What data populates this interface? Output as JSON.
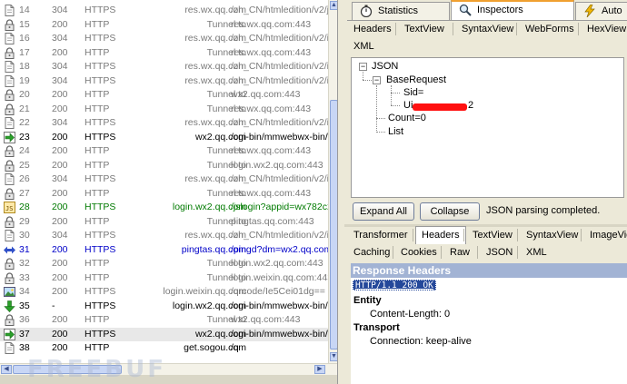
{
  "sessions": [
    {
      "num": "14",
      "result": "304",
      "protocol": "HTTPS",
      "host": "res.wx.qq.com",
      "url": "/zh_CN/htmledition/v2/ji",
      "color": "grey",
      "icon": "document-icon"
    },
    {
      "num": "15",
      "result": "200",
      "protocol": "HTTP",
      "host": "Tunnel to",
      "url": "res.wx.qq.com:443",
      "color": "grey",
      "icon": "lock-icon"
    },
    {
      "num": "16",
      "result": "304",
      "protocol": "HTTPS",
      "host": "res.wx.qq.com",
      "url": "/zh_CN/htmledition/v2/in",
      "color": "grey",
      "icon": "document-icon"
    },
    {
      "num": "17",
      "result": "200",
      "protocol": "HTTP",
      "host": "Tunnel to",
      "url": "res.wx.qq.com:443",
      "color": "grey",
      "icon": "lock-icon"
    },
    {
      "num": "18",
      "result": "304",
      "protocol": "HTTPS",
      "host": "res.wx.qq.com",
      "url": "/zh_CN/htmledition/v2/in",
      "color": "grey",
      "icon": "document-icon"
    },
    {
      "num": "19",
      "result": "304",
      "protocol": "HTTPS",
      "host": "res.wx.qq.com",
      "url": "/zh_CN/htmledition/v2/in",
      "color": "grey",
      "icon": "document-icon"
    },
    {
      "num": "20",
      "result": "200",
      "protocol": "HTTP",
      "host": "Tunnel to",
      "url": "wx2.qq.com:443",
      "color": "grey",
      "icon": "lock-icon"
    },
    {
      "num": "21",
      "result": "200",
      "protocol": "HTTP",
      "host": "Tunnel to",
      "url": "res.wx.qq.com:443",
      "color": "grey",
      "icon": "lock-icon"
    },
    {
      "num": "22",
      "result": "304",
      "protocol": "HTTPS",
      "host": "res.wx.qq.com",
      "url": "/zh_CN/htmledition/v2/in",
      "color": "grey",
      "icon": "document-icon"
    },
    {
      "num": "23",
      "result": "200",
      "protocol": "HTTPS",
      "host": "wx2.qq.com",
      "url": "/cgi-bin/mmwebwx-bin/w",
      "color": "black",
      "icon": "arrow-right-icon"
    },
    {
      "num": "24",
      "result": "200",
      "protocol": "HTTP",
      "host": "Tunnel to",
      "url": "res.wx.qq.com:443",
      "color": "grey",
      "icon": "lock-icon"
    },
    {
      "num": "25",
      "result": "200",
      "protocol": "HTTP",
      "host": "Tunnel to",
      "url": "login.wx2.qq.com:443",
      "color": "grey",
      "icon": "lock-icon"
    },
    {
      "num": "26",
      "result": "304",
      "protocol": "HTTPS",
      "host": "res.wx.qq.com",
      "url": "/zh_CN/htmledition/v2/in",
      "color": "grey",
      "icon": "document-icon"
    },
    {
      "num": "27",
      "result": "200",
      "protocol": "HTTP",
      "host": "Tunnel to",
      "url": "res.wx.qq.com:443",
      "color": "grey",
      "icon": "lock-icon"
    },
    {
      "num": "28",
      "result": "200",
      "protocol": "HTTPS",
      "host": "login.wx2.qq.com",
      "url": "/jslogin?appid=wx782c2",
      "color": "green",
      "icon": "script-icon"
    },
    {
      "num": "29",
      "result": "200",
      "protocol": "HTTP",
      "host": "Tunnel to",
      "url": "pingtas.qq.com:443",
      "color": "grey",
      "icon": "lock-icon"
    },
    {
      "num": "30",
      "result": "304",
      "protocol": "HTTPS",
      "host": "res.wx.qq.com",
      "url": "/zh_CN/htmledition/v2/in",
      "color": "grey",
      "icon": "document-icon"
    },
    {
      "num": "31",
      "result": "200",
      "protocol": "HTTPS",
      "host": "pingtas.qq.com",
      "url": "/pingd?dm=wx2.qq.com",
      "color": "blue",
      "icon": "diamond-arrows-icon"
    },
    {
      "num": "32",
      "result": "200",
      "protocol": "HTTP",
      "host": "Tunnel to",
      "url": "login.wx2.qq.com:443",
      "color": "grey",
      "icon": "lock-icon"
    },
    {
      "num": "33",
      "result": "200",
      "protocol": "HTTP",
      "host": "Tunnel to",
      "url": "login.weixin.qq.com:443",
      "color": "grey",
      "icon": "lock-icon"
    },
    {
      "num": "34",
      "result": "200",
      "protocol": "HTTPS",
      "host": "login.weixin.qq.com",
      "url": "/qrcode/Ie5Cei01dg==",
      "color": "grey",
      "icon": "image-icon"
    },
    {
      "num": "35",
      "result": "-",
      "protocol": "HTTPS",
      "host": "login.wx2.qq.com",
      "url": "/cgi-bin/mmwebwx-bin/l",
      "color": "black",
      "icon": "down-arrow-icon"
    },
    {
      "num": "36",
      "result": "200",
      "protocol": "HTTP",
      "host": "Tunnel to",
      "url": "wx2.qq.com:443",
      "color": "grey",
      "icon": "lock-icon"
    },
    {
      "num": "37",
      "result": "200",
      "protocol": "HTTPS",
      "host": "wx2.qq.com",
      "url": "/cgi-bin/mmwebwx-bin/w",
      "color": "black",
      "icon": "arrow-right-icon",
      "selected": true
    },
    {
      "num": "38",
      "result": "200",
      "protocol": "HTTP",
      "host": "get.sogou.com",
      "url": "/q",
      "color": "black",
      "icon": "document-icon"
    }
  ],
  "top_tabs": {
    "statistics": "Statistics",
    "inspectors": "Inspectors",
    "autoresponder": "Auto"
  },
  "request_tabs": {
    "row1": [
      "Headers",
      "TextView",
      "SyntaxView",
      "WebForms",
      "HexView"
    ],
    "row2": [
      "XML"
    ]
  },
  "json_tree": {
    "root": "JSON",
    "base_request": "BaseRequest",
    "sid": "Sid=",
    "uin_prefix": "Ui",
    "uin_suffix": "2",
    "count": "Count=0",
    "list": "List"
  },
  "buttons": {
    "expand_all": "Expand All",
    "collapse": "Collapse"
  },
  "json_status": "JSON parsing completed.",
  "response_tabs": {
    "row1": [
      "Transformer",
      "Headers",
      "TextView",
      "SyntaxView",
      "ImageView"
    ],
    "row2": [
      "Caching",
      "Cookies",
      "Raw",
      "JSON",
      "XML"
    ]
  },
  "response": {
    "title": "Response Headers",
    "status_line": "HTTP/1.1 200 OK",
    "entity_label": "Entity",
    "content_length": "Content-Length: 0",
    "transport_label": "Transport",
    "connection": "Connection: keep-alive"
  },
  "watermark": "FREEBUF",
  "colors": {
    "grey": "#7a7a7a",
    "green": "#007a00",
    "blue": "#0000c8",
    "response_header_bg": "#a2b3d4",
    "status_line_bg": "#24489a",
    "redaction": "#ff1010"
  }
}
